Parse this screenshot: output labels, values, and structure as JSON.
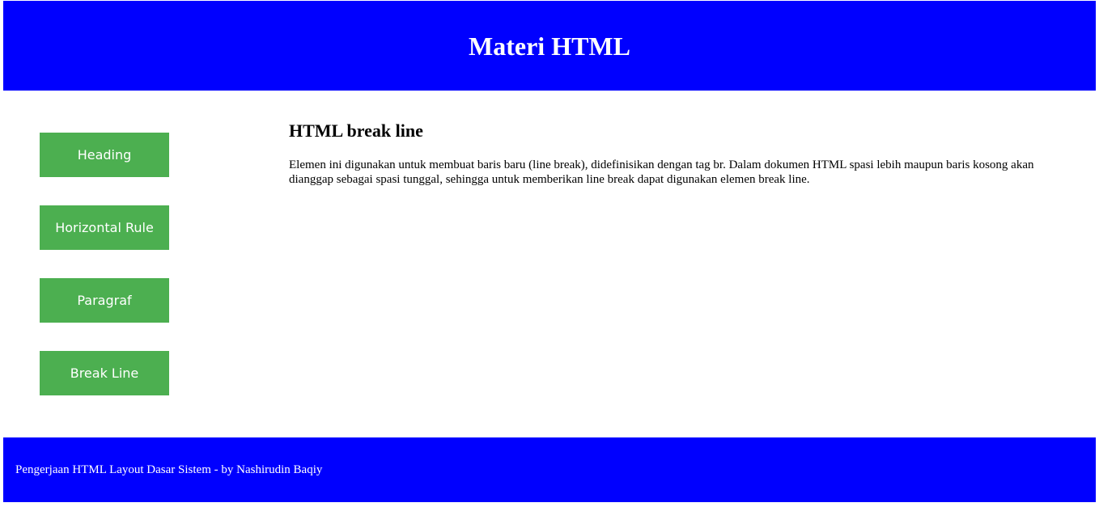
{
  "header": {
    "title": "Materi HTML",
    "background": "#0000ff"
  },
  "nav": {
    "button_color": "#4caf50",
    "items": [
      {
        "label": "Heading"
      },
      {
        "label": "Horizontal Rule"
      },
      {
        "label": "Paragraf"
      },
      {
        "label": "Break Line"
      }
    ]
  },
  "main": {
    "heading": "HTML break line",
    "paragraph": "Elemen ini digunakan untuk membuat baris baru (line break), didefinisikan dengan tag br. Dalam dokumen HTML spasi lebih maupun baris kosong akan dianggap sebagai spasi tunggal, sehingga untuk memberikan line break dapat digunakan elemen break line."
  },
  "footer": {
    "text": "Pengerjaan HTML Layout Dasar Sistem - by Nashirudin Baqiy"
  }
}
